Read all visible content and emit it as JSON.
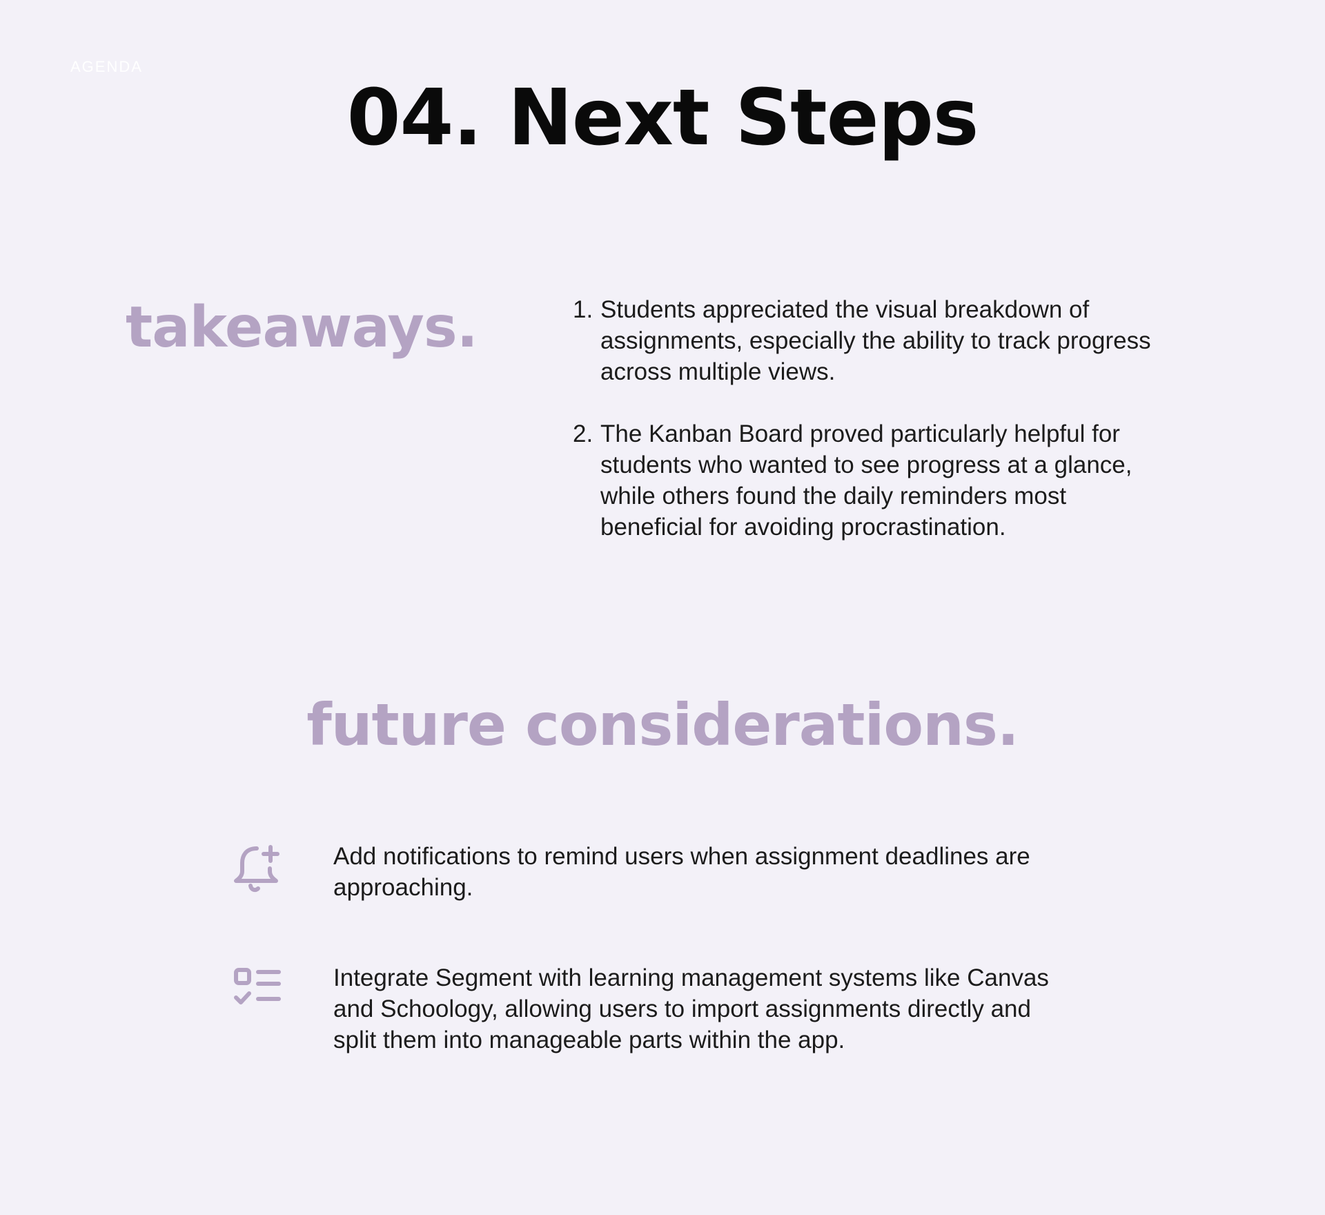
{
  "header": {
    "agenda_label": "AGENDA",
    "title": "04. Next Steps"
  },
  "takeaways": {
    "heading": "takeaways.",
    "items": [
      {
        "number": "1.",
        "text": "Students appreciated the visual breakdown of assignments, especially the ability to track progress across multiple views."
      },
      {
        "number": "2.",
        "text": "The Kanban Board proved particularly helpful for students who wanted to see progress at a glance, while others found the daily reminders most beneficial for avoiding procrastination."
      }
    ]
  },
  "future": {
    "heading": "future considerations.",
    "items": [
      {
        "icon": "bell-plus-icon",
        "text": "Add notifications to remind users when assignment deadlines are approaching."
      },
      {
        "icon": "checklist-icon",
        "text": "Integrate Segment with learning management systems like Canvas and Schoology, allowing users to import assignments directly and split them into manageable parts within the app."
      }
    ]
  },
  "colors": {
    "background": "#f3f1f8",
    "accent": "#b4a3c3",
    "text": "#1c1c1c"
  }
}
